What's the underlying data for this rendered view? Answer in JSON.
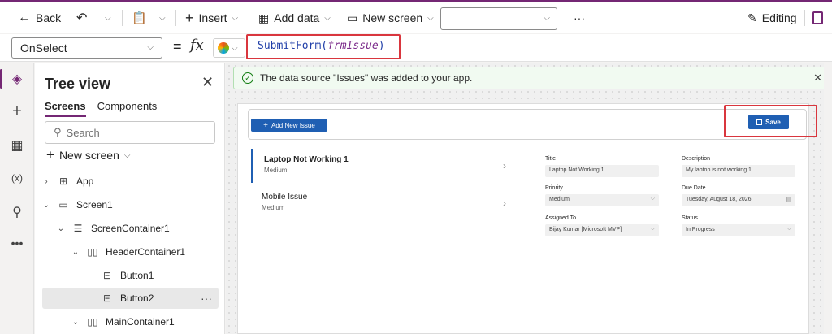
{
  "toolbar": {
    "back": "Back",
    "insert": "Insert",
    "add_data": "Add data",
    "new_screen": "New screen",
    "more": "···",
    "editing": "Editing",
    "dropdown_value": ""
  },
  "formula": {
    "property": "OnSelect",
    "equals": "=",
    "fx": "fx",
    "func": "SubmitForm(",
    "param": "frmIssue",
    "close": ")"
  },
  "tree": {
    "title": "Tree view",
    "tabs": [
      "Screens",
      "Components"
    ],
    "search_placeholder": "Search",
    "new_screen": "New screen",
    "rows": [
      {
        "label": "App",
        "arrow": "›",
        "icon": "app-icon"
      },
      {
        "label": "Screen1",
        "arrow": "⌄",
        "icon": "screen-icon"
      },
      {
        "label": "ScreenContainer1",
        "arrow": "⌄",
        "icon": "container-icon"
      },
      {
        "label": "HeaderContainer1",
        "arrow": "⌄",
        "icon": "horizontal-container-icon"
      },
      {
        "label": "Button1",
        "arrow": "",
        "icon": "button-icon"
      },
      {
        "label": "Button2",
        "arrow": "",
        "icon": "button-icon"
      },
      {
        "label": "MainContainer1",
        "arrow": "⌄",
        "icon": "horizontal-container-icon"
      }
    ]
  },
  "banner": {
    "message": "The data source \"Issues\" was added to your app."
  },
  "app": {
    "add_button": "Add New Issue",
    "save_button": "Save",
    "issues": [
      {
        "title": "Laptop Not Working 1",
        "priority": "Medium"
      },
      {
        "title": "Mobile Issue",
        "priority": "Medium"
      }
    ],
    "form": {
      "title_label": "Title",
      "title_value": "Laptop Not Working 1",
      "description_label": "Description",
      "description_value": "My laptop is not working 1.",
      "priority_label": "Priority",
      "priority_value": "Medium",
      "due_label": "Due Date",
      "due_value": "Tuesday, August 18, 2026",
      "assigned_label": "Assigned To",
      "assigned_value": "Bijay Kumar [Microsoft MVP]",
      "status_label": "Status",
      "status_value": "In Progress"
    }
  },
  "colors": {
    "brand": "#742774",
    "primary_button": "#1f5fb3",
    "highlight": "#d9363e",
    "success": "#107c10"
  }
}
